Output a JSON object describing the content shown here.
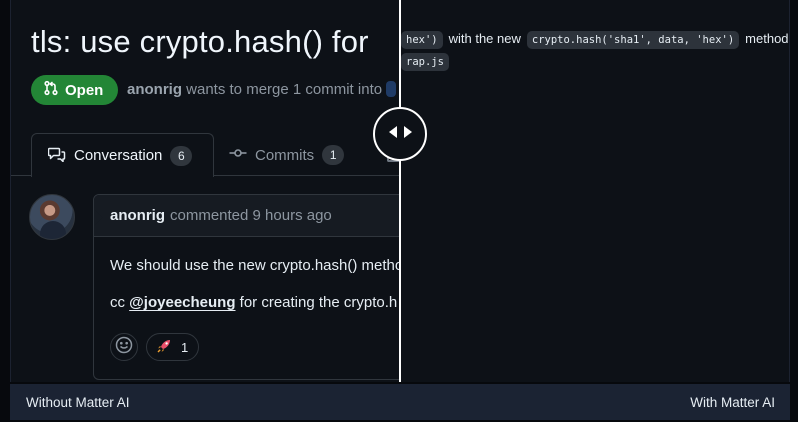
{
  "left": {
    "title": "tls: use crypto.hash() for",
    "status_badge": "Open",
    "author": "anonrig",
    "meta_text": " wants to merge 1 commit into",
    "tabs": [
      {
        "label": "Conversation",
        "count": "6"
      },
      {
        "label": "Commits",
        "count": "1"
      }
    ],
    "comment": {
      "author": "anonrig",
      "time_text": "commented 9 hours ago",
      "line1": "We should use the new crypto.hash() metho",
      "line2_prefix": "cc ",
      "mention": "@joyeecheung",
      "line2_suffix": " for creating the crypto.h",
      "reaction_count": "1"
    }
  },
  "right": {
    "code_fragment_1": "hex')",
    "text_1": "with the new",
    "code_fragment_2": "crypto.hash('sha1', data, 'hex')",
    "text_2": "method",
    "code_fragment_3": "rap.js"
  },
  "captions": {
    "left": "Without Matter AI",
    "right": "With Matter AI"
  },
  "icons": {
    "badge": "git-pull-request-icon",
    "conversation": "comment-discussion-icon",
    "commits": "git-commit-icon",
    "add_reaction": "smiley-icon",
    "reaction": "rocket-icon",
    "handle_left": "triangle-left-icon",
    "handle_right": "triangle-right-icon"
  },
  "colors": {
    "badge_green": "#238636",
    "background": "#0d1117",
    "divider": "#ffffff",
    "caption_bar": "#1b2333"
  }
}
